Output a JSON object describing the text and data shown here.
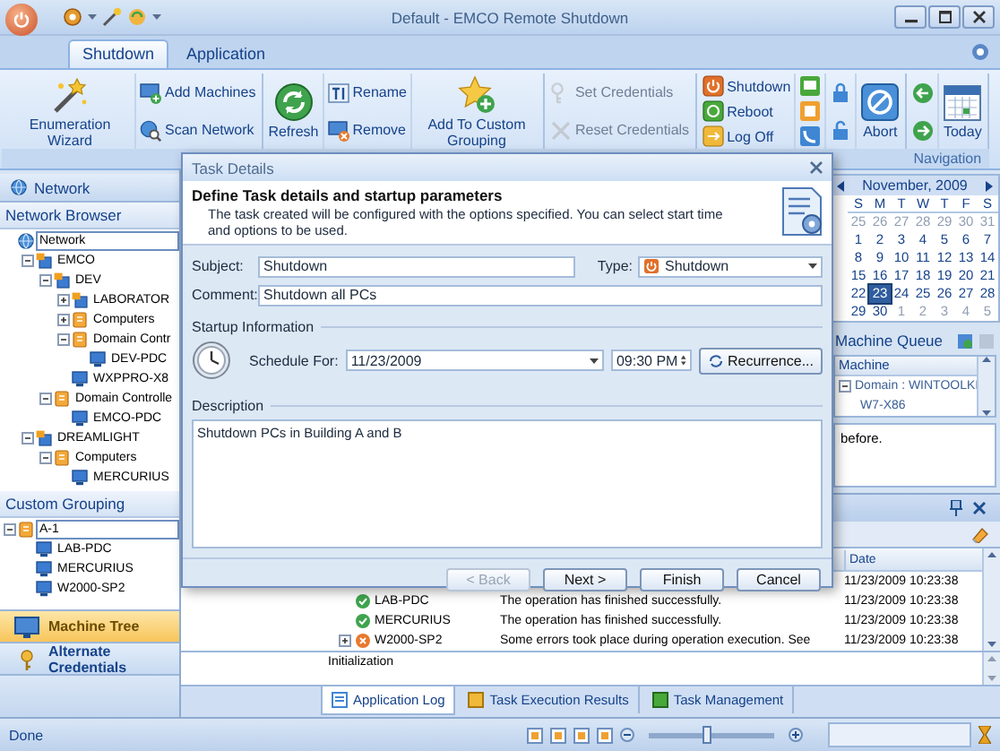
{
  "window": {
    "title": "Default - EMCO Remote Shutdown"
  },
  "ribbon": {
    "tabs": [
      {
        "label": "Shutdown",
        "selected": true
      },
      {
        "label": "Application",
        "selected": false
      }
    ],
    "groups": [
      {
        "columns": [
          [
            {
              "kind": "large",
              "label": "Enumeration Wizard",
              "disabled": false
            }
          ],
          [
            {
              "kind": "small",
              "label": "Add Machines",
              "disabled": false
            },
            {
              "kind": "small",
              "label": "Scan Network",
              "disabled": false
            }
          ]
        ]
      },
      {
        "columns": [
          [
            {
              "kind": "large",
              "label": "Refresh",
              "disabled": false
            }
          ],
          [
            {
              "kind": "small",
              "label": "Rename",
              "disabled": false
            },
            {
              "kind": "small",
              "label": "Remove",
              "disabled": false
            }
          ],
          [
            {
              "kind": "large",
              "label": "Add To Custom Grouping",
              "disabled": false
            }
          ]
        ]
      },
      {
        "columns": [
          [
            {
              "kind": "small",
              "label": "Set Credentials",
              "disabled": true
            },
            {
              "kind": "small",
              "label": "Reset Credentials",
              "disabled": true
            }
          ]
        ]
      },
      {
        "columns": [
          [
            {
              "kind": "small",
              "label": "Shutdown",
              "disabled": false
            },
            {
              "kind": "small",
              "label": "Reboot",
              "disabled": false
            },
            {
              "kind": "small",
              "label": "Log Off",
              "disabled": false
            }
          ],
          [
            {
              "kind": "icon",
              "disabled": false
            },
            {
              "kind": "icon",
              "disabled": false
            },
            {
              "kind": "icon",
              "disabled": false
            }
          ],
          [
            {
              "kind": "icon",
              "disabled": false
            },
            {
              "kind": "icon",
              "disabled": false
            }
          ],
          [
            {
              "kind": "large",
              "label": "Abort",
              "disabled": false
            }
          ]
        ]
      },
      {
        "label": "Navigation",
        "columns": [
          [
            {
              "kind": "icon",
              "disabled": false
            },
            {
              "kind": "icon",
              "disabled": false
            }
          ],
          [
            {
              "kind": "large",
              "label": "Today",
              "disabled": false
            }
          ]
        ]
      }
    ]
  },
  "left_panel": {
    "header": "Network",
    "network_browser": {
      "title": "Network Browser",
      "tree": [
        {
          "label": "Network",
          "kind": "network",
          "selected": true,
          "children": [
            {
              "label": "EMCO",
              "kind": "domain",
              "selected": false,
              "expanded": true,
              "children": [
                {
                  "label": "DEV",
                  "kind": "domain",
                  "selected": false,
                  "expanded": true,
                  "children": [
                    {
                      "label": "LABORATOR",
                      "kind": "domain",
                      "selected": false,
                      "expanded": false
                    },
                    {
                      "label": "Computers",
                      "kind": "group",
                      "selected": false,
                      "expanded": false
                    },
                    {
                      "label": "Domain Contr",
                      "kind": "group",
                      "selected": false,
                      "expanded": true,
                      "children": [
                        {
                          "label": "DEV-PDC",
                          "kind": "computer",
                          "selected": false
                        }
                      ]
                    },
                    {
                      "label": "WXPPRO-X8",
                      "kind": "computer",
                      "selected": false
                    }
                  ]
                },
                {
                  "label": "Domain Controlle",
                  "kind": "group",
                  "selected": false,
                  "expanded": true,
                  "children": [
                    {
                      "label": "EMCO-PDC",
                      "kind": "computer",
                      "selected": false
                    }
                  ]
                }
              ]
            },
            {
              "label": "DREAMLIGHT",
              "kind": "domain",
              "selected": false,
              "expanded": true,
              "children": [
                {
                  "label": "Computers",
                  "kind": "group",
                  "selected": false,
                  "expanded": true,
                  "children": [
                    {
                      "label": "MERCURIUS",
                      "kind": "computer",
                      "selected": false
                    }
                  ]
                }
              ]
            }
          ]
        }
      ]
    },
    "custom_grouping": {
      "title": "Custom Grouping",
      "tree": [
        {
          "label": "A-1",
          "kind": "group",
          "selected": true,
          "expanded": true,
          "children": [
            {
              "label": "LAB-PDC",
              "kind": "computer",
              "selected": false
            },
            {
              "label": "MERCURIUS",
              "kind": "computer",
              "selected": false
            },
            {
              "label": "W2000-SP2",
              "kind": "computer",
              "selected": false
            }
          ]
        }
      ]
    },
    "nav_buttons": [
      {
        "label": "Machine Tree",
        "selected": true
      },
      {
        "label": "Alternate Credentials",
        "selected": false
      }
    ]
  },
  "calendar": {
    "month": "November, 2009",
    "weekdays": [
      "S",
      "M",
      "T",
      "W",
      "T",
      "F",
      "S"
    ],
    "weeks": [
      {
        "days": [
          {
            "day": "25",
            "muted": true,
            "selected": false
          },
          {
            "day": "26",
            "muted": true,
            "selected": false
          },
          {
            "day": "27",
            "muted": true,
            "selected": false
          },
          {
            "day": "28",
            "muted": true,
            "selected": false
          },
          {
            "day": "29",
            "muted": true,
            "selected": false
          },
          {
            "day": "30",
            "muted": true,
            "selected": false
          },
          {
            "day": "31",
            "muted": true,
            "selected": false
          }
        ]
      },
      {
        "days": [
          {
            "day": "1",
            "muted": false,
            "selected": false
          },
          {
            "day": "2",
            "muted": false,
            "selected": false
          },
          {
            "day": "3",
            "muted": false,
            "selected": false
          },
          {
            "day": "4",
            "muted": false,
            "selected": false
          },
          {
            "day": "5",
            "muted": false,
            "selected": false
          },
          {
            "day": "6",
            "muted": false,
            "selected": false
          },
          {
            "day": "7",
            "muted": false,
            "selected": false
          }
        ]
      },
      {
        "days": [
          {
            "day": "8",
            "muted": false,
            "selected": false
          },
          {
            "day": "9",
            "muted": false,
            "selected": false
          },
          {
            "day": "10",
            "muted": false,
            "selected": false
          },
          {
            "day": "11",
            "muted": false,
            "selected": false
          },
          {
            "day": "12",
            "muted": false,
            "selected": false
          },
          {
            "day": "13",
            "muted": false,
            "selected": false
          },
          {
            "day": "14",
            "muted": false,
            "selected": false
          }
        ]
      },
      {
        "days": [
          {
            "day": "15",
            "muted": false,
            "selected": false
          },
          {
            "day": "16",
            "muted": false,
            "selected": false
          },
          {
            "day": "17",
            "muted": false,
            "selected": false
          },
          {
            "day": "18",
            "muted": false,
            "selected": false
          },
          {
            "day": "19",
            "muted": false,
            "selected": false
          },
          {
            "day": "20",
            "muted": false,
            "selected": false
          },
          {
            "day": "21",
            "muted": false,
            "selected": false
          }
        ]
      },
      {
        "days": [
          {
            "day": "22",
            "muted": false,
            "selected": false
          },
          {
            "day": "23",
            "muted": false,
            "selected": true
          },
          {
            "day": "24",
            "muted": false,
            "selected": false
          },
          {
            "day": "25",
            "muted": false,
            "selected": false
          },
          {
            "day": "26",
            "muted": false,
            "selected": false
          },
          {
            "day": "27",
            "muted": false,
            "selected": false
          },
          {
            "day": "28",
            "muted": false,
            "selected": false
          }
        ]
      },
      {
        "days": [
          {
            "day": "29",
            "muted": false,
            "selected": false
          },
          {
            "day": "30",
            "muted": false,
            "selected": false
          },
          {
            "day": "1",
            "muted": true,
            "selected": false
          },
          {
            "day": "2",
            "muted": true,
            "selected": false
          },
          {
            "day": "3",
            "muted": true,
            "selected": false
          },
          {
            "day": "4",
            "muted": true,
            "selected": false
          },
          {
            "day": "5",
            "muted": true,
            "selected": false
          }
        ]
      }
    ]
  },
  "machine_queue": {
    "title": "Machine Queue",
    "column": "Machine",
    "rows": [
      {
        "label": "Domain : WINTOOLKI",
        "expanded": true,
        "children": [
          {
            "label": "W7-X86"
          }
        ]
      }
    ],
    "description": "before."
  },
  "log_panel": {
    "date_header": "Date",
    "rows": [
      {
        "date": "11/23/2009 10:23:38"
      },
      {
        "kind": "success",
        "machine": "LAB-PDC",
        "message": "The operation has finished successfully.",
        "date": "11/23/2009 10:23:38"
      },
      {
        "kind": "success",
        "machine": "MERCURIUS",
        "message": "The operation has finished successfully.",
        "date": "11/23/2009 10:23:38"
      },
      {
        "kind": "error",
        "expanded": false,
        "machine": "W2000-SP2",
        "message": "Some errors took place during operation execution. See",
        "date": "11/23/2009 10:23:38"
      }
    ],
    "output": "Initialization",
    "tabs": [
      {
        "label": "Application Log",
        "selected": true
      },
      {
        "label": "Task Execution Results",
        "selected": false
      },
      {
        "label": "Task Management",
        "selected": false
      }
    ]
  },
  "status_bar": {
    "text": "Done",
    "zoom": {
      "level": 0.45
    }
  },
  "task_dialog": {
    "title": "Task Details",
    "heading": "Define Task details and startup parameters",
    "intro": "The task created will be configured with the options specified. You can select start time and options to be used.",
    "subject": {
      "label": "Subject:",
      "value": "Shutdown"
    },
    "type": {
      "label": "Type:",
      "value": "Shutdown"
    },
    "comment": {
      "label": "Comment:",
      "value": "Shutdown all PCs"
    },
    "startup_section": "Startup Information",
    "schedule": {
      "label": "Schedule For:",
      "date": "11/23/2009",
      "time": "09:30 PM",
      "recurrence_button": "Recurrence..."
    },
    "description": {
      "label": "Description",
      "value": "Shutdown PCs in Building A and B"
    },
    "buttons": [
      {
        "label": "< Back",
        "disabled": true
      },
      {
        "label": "Next >",
        "disabled": false
      },
      {
        "label": "Finish",
        "disabled": false
      },
      {
        "label": "Cancel",
        "disabled": false
      }
    ]
  }
}
